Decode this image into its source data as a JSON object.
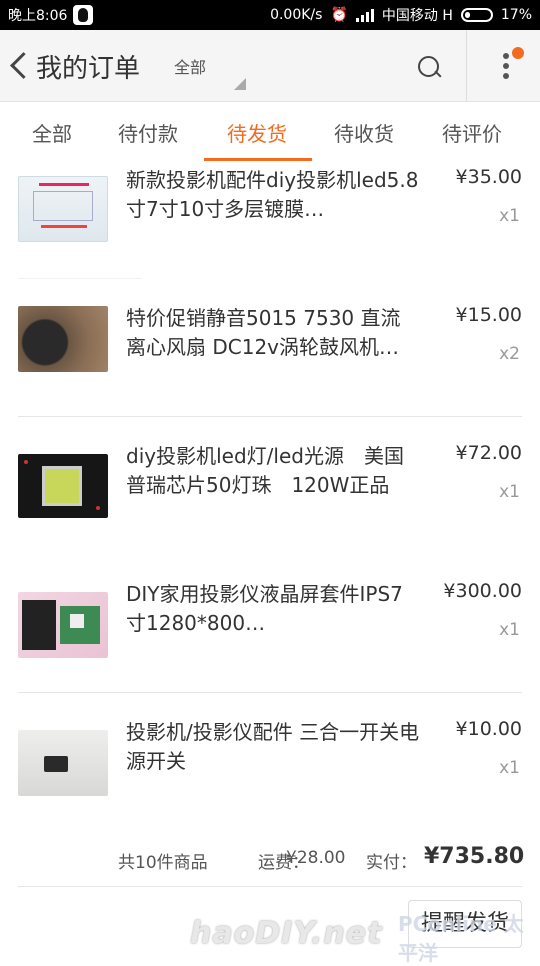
{
  "status_bar": {
    "time": "晚上8:06",
    "speed": "0.00K/s",
    "carrier": "中国移动 H",
    "battery": "17%"
  },
  "header": {
    "back_icon": "chevron-left-icon",
    "title": "我的订单",
    "filter_label": "全部",
    "search_icon": "search-icon",
    "more_icon": "more-vertical-icon",
    "badge_color": "#f26b21"
  },
  "tabs": [
    {
      "label": "全部"
    },
    {
      "label": "待付款"
    },
    {
      "label": "待发货",
      "active": true
    },
    {
      "label": "待收货"
    },
    {
      "label": "待评价"
    }
  ],
  "accent_color": "#f26b21",
  "items": [
    {
      "name": "新款投影机配件diy投影机led5.8寸7寸10寸多层镀膜…",
      "price": "¥35.00",
      "qty": "x1"
    },
    {
      "name": "特价促销静音5015 7530 直流离心风扇 DC12v涡轮鼓风机…",
      "price": "¥15.00",
      "qty": "x2"
    },
    {
      "name": "diy投影机led灯/led光源　美国普瑞芯片50灯珠　120W正品",
      "price": "¥72.00",
      "qty": "x1"
    },
    {
      "name": "DIY家用投影仪液晶屏套件IPS7寸1280*800…",
      "price": "¥300.00",
      "qty": "x1"
    },
    {
      "name": "投影机/投影仪配件  三合一开关电源开关",
      "price": "¥10.00",
      "qty": "x1"
    }
  ],
  "summary": {
    "count": "共10件商品",
    "shipping_label": "运费：",
    "shipping": "¥28.00",
    "paid_label": "实付：",
    "total": "¥735.80"
  },
  "remind_button": "提醒发货",
  "watermark": "haoDIY.net",
  "watermark2": "PConline 太平洋"
}
